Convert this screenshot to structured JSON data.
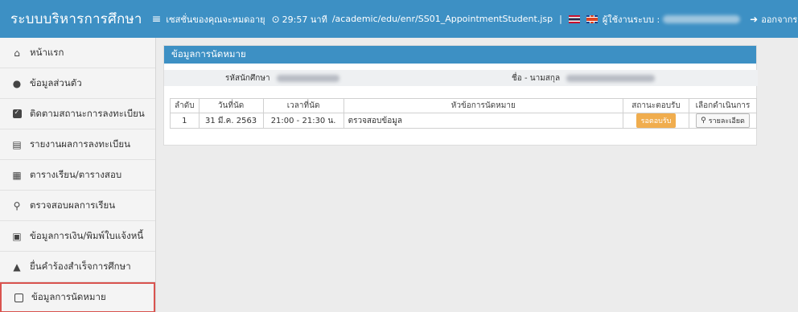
{
  "header": {
    "brand": "ระบบบริหารการศึกษา",
    "session_label": "เซสชั่นของคุณจะหมดอายุ",
    "session_time": "29:57 นาที",
    "url": "/academic/edu/enr/SS01_AppointmentStudent.jsp",
    "user_label": "ผู้ใช้งานระบบ :",
    "logout": "ออกจากระบ"
  },
  "sidebar": {
    "items": [
      {
        "label": "หน้าแรก",
        "icon": "home-icon"
      },
      {
        "label": "ข้อมูลส่วนตัว",
        "icon": "user-icon"
      },
      {
        "label": "ติดตามสถานะการลงทะเบียน",
        "icon": "checkbox-icon"
      },
      {
        "label": "รายงานผลการลงทะเบียน",
        "icon": "file-icon"
      },
      {
        "label": "ตารางเรียน/ตารางสอบ",
        "icon": "table-icon"
      },
      {
        "label": "ตรวจสอบผลการเรียน",
        "icon": "search-icon"
      },
      {
        "label": "ข้อมูลการเงิน/พิมพ์ใบแจ้งหนี้",
        "icon": "money-icon"
      },
      {
        "label": "ยื่นคำร้องสำเร็จการศึกษา",
        "icon": "graduation-cap-icon"
      },
      {
        "label": "ข้อมูลการนัดหมาย",
        "icon": "calendar-check-icon",
        "active": true
      }
    ]
  },
  "panel": {
    "title": "ข้อมูลการนัดหมาย",
    "student_id_label": "รหัสนักศึกษา",
    "name_label": "ชื่อ - นามสกุล",
    "table": {
      "headers": [
        "ลำดับ",
        "วันที่นัด",
        "เวลาที่นัด",
        "หัวข้อการนัดหมาย",
        "สถานะตอบรับ",
        "เลือกดำเนินการ"
      ],
      "rows": [
        {
          "no": "1",
          "date": "31 มี.ค. 2563",
          "time": "21:00 - 21:30 น.",
          "topic": "ตรวจสอบข้อมูล",
          "status": "รอตอบรับ",
          "action": "รายละเอียด"
        }
      ]
    }
  },
  "colors": {
    "primary": "#3d90c4",
    "status_badge": "#f0ad4e",
    "active_border": "#d9534f"
  }
}
